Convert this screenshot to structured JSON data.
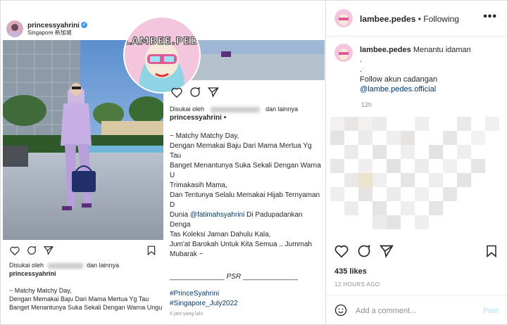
{
  "inner_post": {
    "username": "princessyahrini",
    "location": "Singapore 新加坡",
    "likes_prefix": "Disukai oleh",
    "likes_suffix": "dan lainnya",
    "caption_user": "princessyahrini",
    "caption_lines": [
      "~ Matchy Matchy Day,",
      "Dengan Memakai Baju Dari Mama Mertua Yg Tau",
      "Banget Menantunya Suka Sekali Dengan Warna Ungu"
    ]
  },
  "overlay_post": {
    "likes_prefix": "Disukai oleh",
    "likes_suffix": "dan lainnya",
    "caption_user": "princessyahrini",
    "caption_lines": [
      "~ Matchy Matchy Day,",
      "Dengan Memakai Baju Dari Mama Mertua Yg Tau",
      "Banget Menantunya Suka Sekali Dengan Warna U",
      "Trimakasih Mama,",
      "Dan Tentunya Selalu Memakai Hijab Ternyaman D",
      "Dunia",
      "Di Padupadankan Denga",
      "Tas Koleksi Jaman Dahulu Kala,",
      "Jum'at Barokah Untuk Kita Semua .. Jummah",
      "Mubarak ~"
    ],
    "mention": "@fatimahsyahrini",
    "signature": "PSR",
    "hashtags": [
      "#PrinceSyahrini",
      "#Singapore_July2022"
    ],
    "time": "5 jam yang lalu"
  },
  "logo": {
    "text": "LAMBEE.PEDES"
  },
  "right_panel": {
    "username": "lambee.pedes",
    "separator": "•",
    "follow_status": "Following",
    "more": "•••",
    "caption_user": "lambee.pedes",
    "caption_text": "Menantu idaman",
    "caption_dots": [
      ".",
      "."
    ],
    "caption_follow": "Follow akun cadangan",
    "caption_link": "@lambe.pedes.official",
    "time": "12h",
    "likes": "435 likes",
    "ago": "12 HOURS AGO",
    "comment_placeholder": "Add a comment...",
    "post_label": "Post"
  },
  "colors": {
    "link": "#00376b",
    "post_disabled": "#b2dffc",
    "verified": "#3897f0"
  }
}
